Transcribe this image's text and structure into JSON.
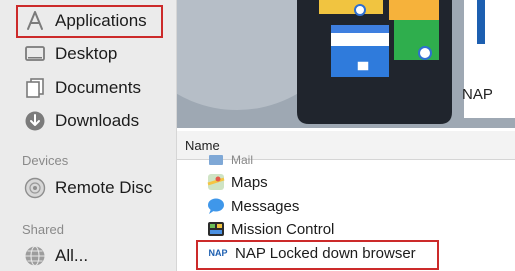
{
  "sidebar": {
    "favorites": [
      {
        "label": "Applications",
        "icon": "applications-icon"
      },
      {
        "label": "Desktop",
        "icon": "desktop-icon"
      },
      {
        "label": "Documents",
        "icon": "documents-icon"
      },
      {
        "label": "Downloads",
        "icon": "downloads-icon"
      }
    ],
    "devices_header": "Devices",
    "devices": [
      {
        "label": "Remote Disc",
        "icon": "remote-disc-icon"
      }
    ],
    "shared_header": "Shared",
    "shared": [
      {
        "label": "All...",
        "icon": "network-icon"
      }
    ]
  },
  "preview": {
    "caption": "NAP"
  },
  "list": {
    "column_name": "Name",
    "items": [
      {
        "label": "Mail",
        "icon": "mail-icon"
      },
      {
        "label": "Maps",
        "icon": "maps-icon"
      },
      {
        "label": "Messages",
        "icon": "messages-icon"
      },
      {
        "label": "Mission Control",
        "icon": "mission-control-icon"
      },
      {
        "label": "NAP Locked down browser",
        "icon": "nap-app-icon",
        "icon_text": "NAP"
      }
    ]
  },
  "colors": {
    "highlight": "#cc2a2a",
    "sidebar_bg": "#ebebeb",
    "accent": "#1d5fb0"
  }
}
